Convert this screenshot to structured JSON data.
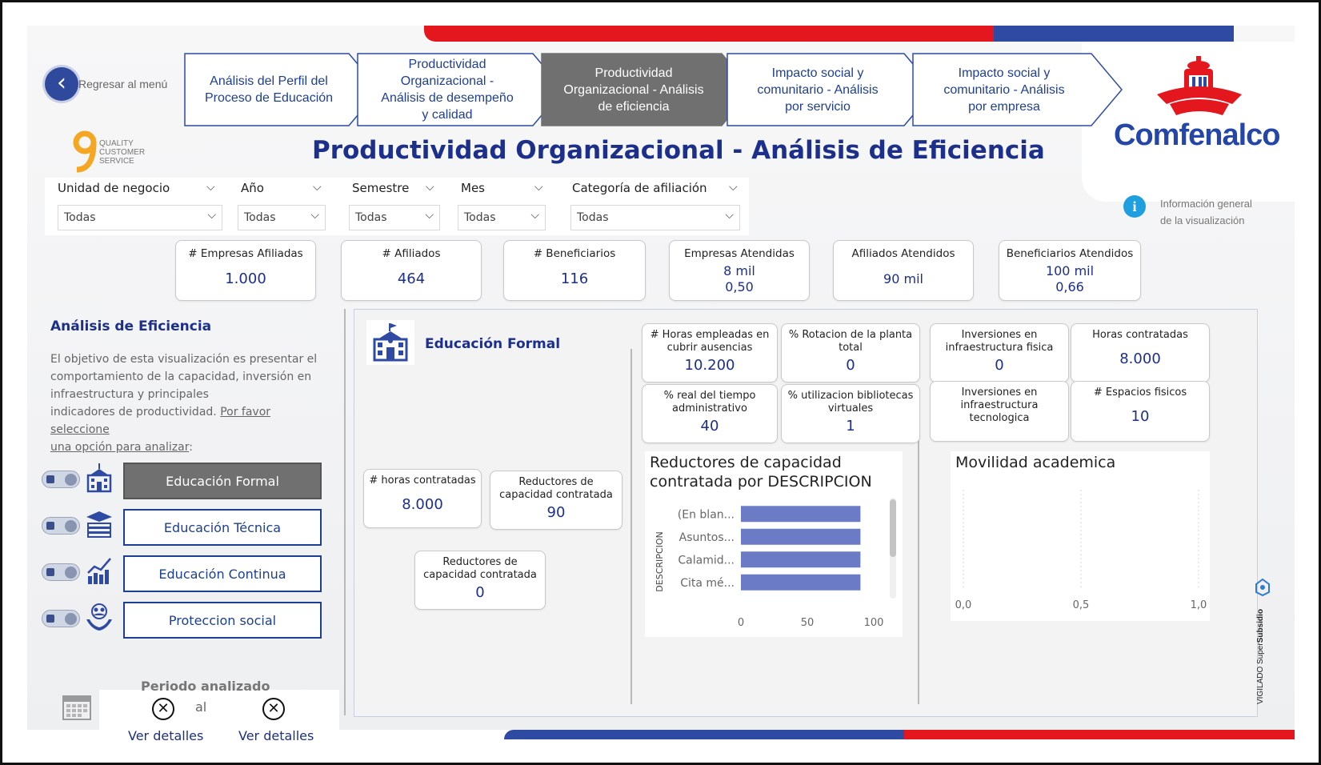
{
  "nav": {
    "back_label": "Regresar al menú",
    "items": [
      {
        "label_lines": [
          "Análisis del Perfil del",
          "Proceso de Educación"
        ]
      },
      {
        "label_lines": [
          "Productividad",
          "Organizacional -",
          "Análisis de desempeño",
          "y calidad"
        ]
      },
      {
        "label_lines": [
          "Productividad",
          "Organizacional - Análisis",
          "de eficiencia"
        ]
      },
      {
        "label_lines": [
          "Impacto social y",
          "comunitario - Análisis",
          "por servicio"
        ]
      },
      {
        "label_lines": [
          "Impacto social y",
          "comunitario - Análisis",
          "por empresa"
        ]
      }
    ],
    "active_index": 2
  },
  "quality_logo": {
    "lines": [
      "QUALITY",
      "CUSTOMER",
      "SERVICE"
    ]
  },
  "brand": {
    "name": "Comfenalco"
  },
  "page_title": "Productividad Organizacional - Análisis de Eficiencia",
  "filters": [
    {
      "label": "Unidad de negocio",
      "value": "Todas"
    },
    {
      "label": "Año",
      "value": "Todas"
    },
    {
      "label": "Semestre",
      "value": "Todas"
    },
    {
      "label": "Mes",
      "value": "Todas"
    },
    {
      "label": "Categoría de afiliación",
      "value": "Todas"
    }
  ],
  "info": {
    "lines": [
      "Información general",
      "de la visualización"
    ]
  },
  "kpis": [
    {
      "title": "# Empresas Afiliadas",
      "values": [
        "1.000"
      ]
    },
    {
      "title": "# Afiliados",
      "values": [
        "464"
      ]
    },
    {
      "title": "# Beneficiarios",
      "values": [
        "116"
      ]
    },
    {
      "title": "Empresas Atendidas",
      "values": [
        "8 mil",
        "0,50"
      ]
    },
    {
      "title": "Afiliados Atendidos",
      "values": [
        "90 mil"
      ]
    },
    {
      "title": "Beneficiarios Atendidos",
      "values": [
        "100 mil",
        "0,66"
      ]
    }
  ],
  "left": {
    "title": "Análisis de Eficiencia",
    "desc_lines": [
      "El objetivo de esta visualización es presentar el",
      "comportamiento de la capacidad, inversión en",
      "infraestructura y principales"
    ],
    "desc_last": "indicadores de productividad. ",
    "desc_link_1": "Por favor seleccione",
    "desc_link_2": "una opción para analizar",
    "desc_end": ":",
    "options": [
      {
        "label": "Educación Formal",
        "icon": "school-building-icon",
        "selected": true
      },
      {
        "label": "Educación Técnica",
        "icon": "books-stack-icon",
        "selected": false
      },
      {
        "label": "Educación Continua",
        "icon": "growth-chart-icon",
        "selected": false
      },
      {
        "label": "Proteccion social",
        "icon": "hands-people-icon",
        "selected": false
      }
    ]
  },
  "period": {
    "title": "Periodo analizado",
    "sep": "al",
    "start_link": "Ver detalles",
    "end_link": "Ver detalles"
  },
  "section": {
    "title": "Educación Formal"
  },
  "metric_cards": [
    {
      "title_lines": [
        "# Horas empleadas en",
        "cubrir ausencias"
      ],
      "value": "10.200"
    },
    {
      "title_lines": [
        "% Rotacion de la planta",
        "total"
      ],
      "value": "0"
    },
    {
      "title_lines": [
        "Inversiones en",
        "infraestructura fisica"
      ],
      "value": "0"
    },
    {
      "title_lines": [
        "Horas contratadas"
      ],
      "value": "8.000"
    },
    {
      "title_lines": [
        "% real del tiempo",
        "administrativo"
      ],
      "value": "40"
    },
    {
      "title_lines": [
        "% utilizacion bibliotecas",
        "virtuales"
      ],
      "value": "1"
    },
    {
      "title_lines": [
        "Inversiones en",
        "infraestructura",
        "tecnologica"
      ],
      "value": ""
    },
    {
      "title_lines": [
        "# Espacios fisicos"
      ],
      "value": "10"
    },
    {
      "title_lines": [
        "# horas contratadas"
      ],
      "value": "8.000"
    },
    {
      "title_lines": [
        "Reductores de",
        "capacidad contratada"
      ],
      "value": "90"
    },
    {
      "title_lines": [
        "Reductores de",
        "capacidad contratada"
      ],
      "value": "0"
    }
  ],
  "chart_data": [
    {
      "type": "bar",
      "orientation": "horizontal",
      "title": "Reductores de capacidad contratada por DESCRIPCION",
      "ylabel": "DESCRIPCION",
      "xlabel": "",
      "categories": [
        "(En blan...",
        "Asuntos...",
        "Calamid...",
        "Cita mé..."
      ],
      "values": [
        90,
        90,
        90,
        90
      ],
      "xlim": [
        0,
        100
      ],
      "xticks": [
        "0",
        "50",
        "100"
      ],
      "bar_color": "#6b7bc6",
      "scrollbar": true
    },
    {
      "type": "scatter",
      "title": "Movilidad academica",
      "xlim": [
        0,
        1
      ],
      "xticks": [
        "0,0",
        "0,5",
        "1,0"
      ],
      "series": [],
      "grid": "vertical dashed"
    }
  ],
  "footer_badge": {
    "text_a": "VIGILADO ",
    "text_b": "Super",
    "text_c": "Subsidio"
  },
  "colors": {
    "brand_blue": "#1c2f8a",
    "brand_red": "#e3171d",
    "nav_active": "#707070",
    "bar": "#6b7bc6"
  }
}
